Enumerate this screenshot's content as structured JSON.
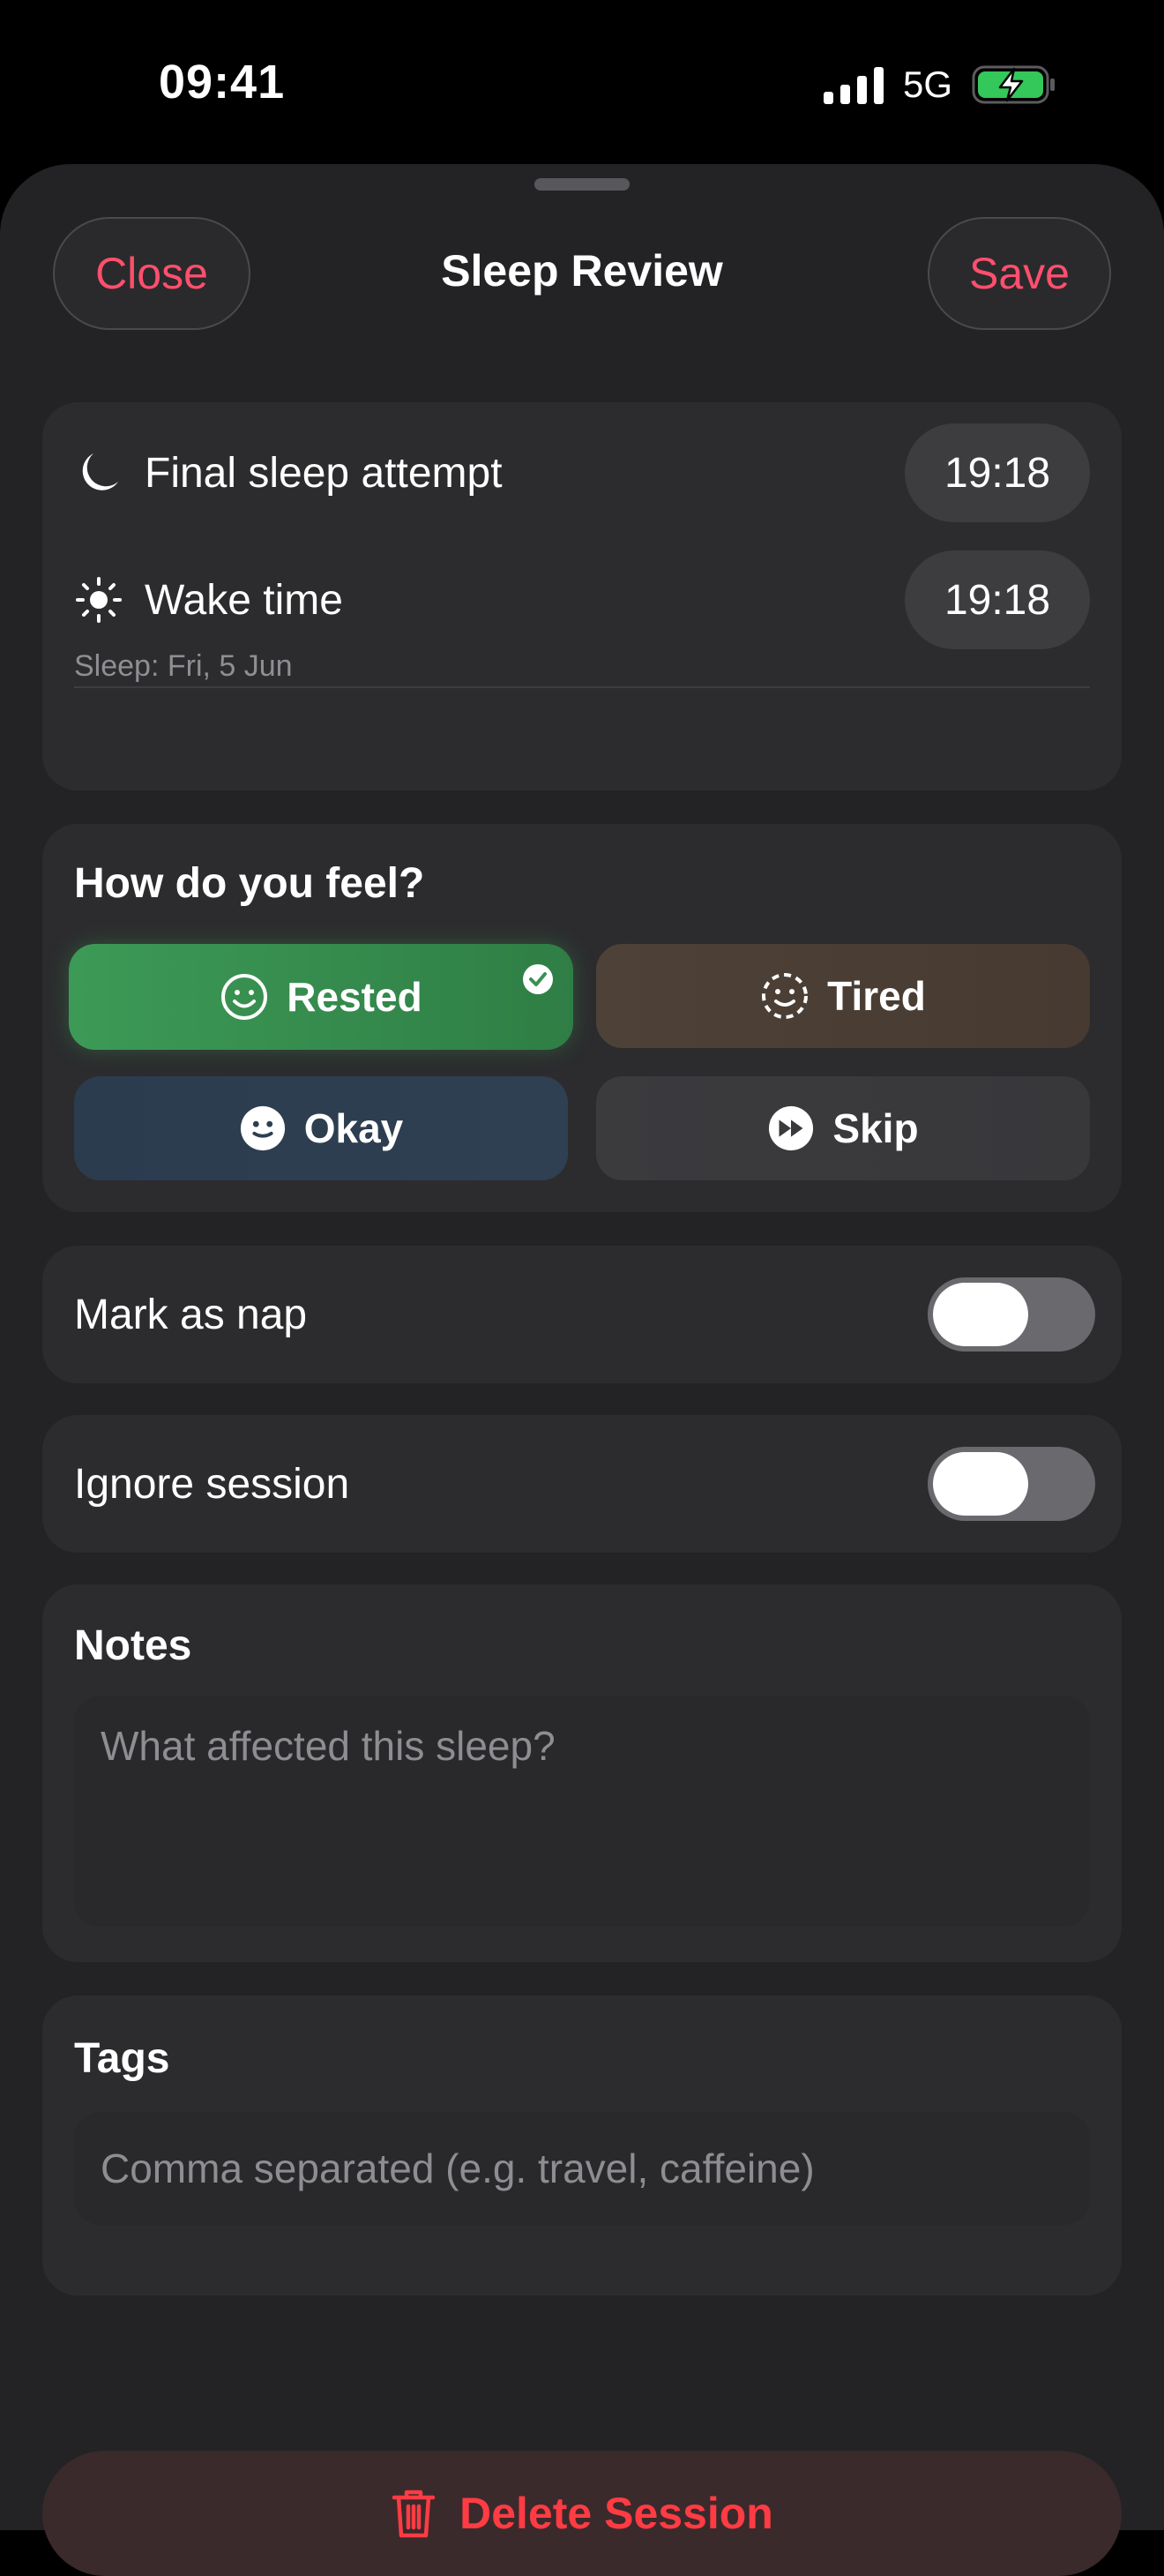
{
  "status_bar": {
    "time": "09:41",
    "network": "5G",
    "battery_charging": true,
    "battery_color": "#34c759"
  },
  "header": {
    "close_label": "Close",
    "title": "Sleep Review",
    "save_label": "Save",
    "accent_color": "#ff4f6e"
  },
  "times": {
    "sleep_label": "Final sleep attempt",
    "sleep_icon": "moon-icon",
    "sleep_value": "19:18",
    "wake_label": "Wake time",
    "wake_icon": "sun-icon",
    "wake_value": "19:18",
    "date_note": "Sleep: Fri, 5 Jun"
  },
  "feel": {
    "heading": "How do you feel?",
    "options": [
      {
        "label": "Rested",
        "icon": "smile-icon",
        "selected": true,
        "color": "#3c9a56"
      },
      {
        "label": "Tired",
        "icon": "dashed-smile-icon",
        "selected": false,
        "color": "#4e4238"
      },
      {
        "label": "Okay",
        "icon": "neutral-face-icon",
        "selected": false,
        "color": "#2b3c4f"
      },
      {
        "label": "Skip",
        "icon": "forward-icon",
        "selected": false,
        "color": "#3b3b3e"
      }
    ]
  },
  "toggles": {
    "nap_label": "Mark as nap",
    "nap_on": false,
    "ignore_label": "Ignore session",
    "ignore_on": false
  },
  "notes": {
    "heading": "Notes",
    "placeholder": "What affected this sleep?",
    "value": ""
  },
  "tags": {
    "heading": "Tags",
    "placeholder": "Comma separated (e.g. travel, caffeine)",
    "value": ""
  },
  "delete": {
    "label": "Delete Session",
    "icon": "trash-icon",
    "color": "#ff3b43"
  }
}
